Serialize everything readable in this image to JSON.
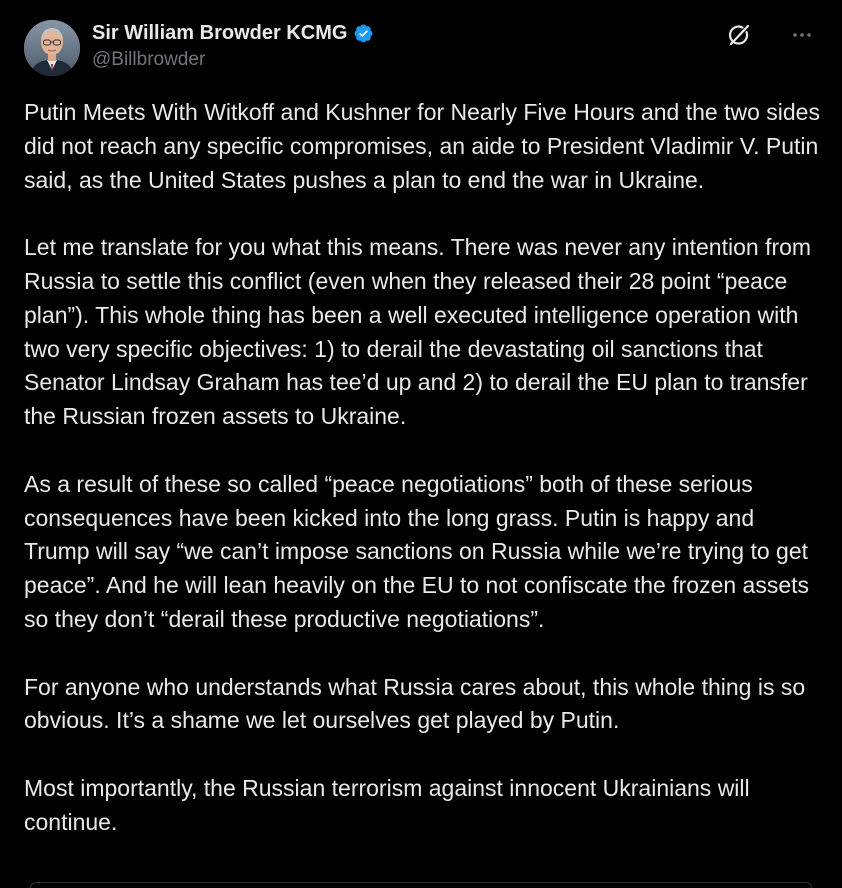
{
  "author": {
    "display_name": "Sir William Browder KCMG",
    "handle": "@Billbrowder",
    "avatar_icon": "profile-photo",
    "verified_icon": "verified-badge-icon",
    "verified_color": "#1d9bf0"
  },
  "actions": {
    "grok_icon": "grok-icon",
    "more_icon": "more-icon"
  },
  "tweet": {
    "paragraphs": [
      "Putin Meets With Witkoff and Kushner for Nearly Five Hours and the two sides did not reach any specific compromises, an aide to President Vladimir V. Putin said, as the United States pushes a plan to end the war in Ukraine.",
      "Let me translate for you what this means. There was never any intention from Russia to settle this conflict (even when they released their 28 point “peace plan”). This whole thing has been a well executed intelligence operation with two very specific objectives: 1) to derail the devastating oil sanctions that Senator Lindsay Graham has tee’d up and 2) to derail the EU plan to transfer the Russian frozen assets to Ukraine.",
      "As a result of these so called “peace negotiations” both of these serious consequences have been kicked into the long grass. Putin is happy and Trump will say “we can’t impose sanctions on Russia while we’re trying to get peace”. And he will lean heavily on the EU to not confiscate the frozen assets so they don’t “derail these productive negotiations”.",
      "For anyone who understands what Russia cares about, this whole thing is so obvious. It’s a shame we let ourselves get played by Putin.",
      "Most importantly, the Russian terrorism against innocent Ukrainians will continue."
    ]
  },
  "colors": {
    "background": "#000000",
    "text_primary": "#e7e9ea",
    "text_secondary": "#71767b",
    "border": "#2f3336"
  }
}
